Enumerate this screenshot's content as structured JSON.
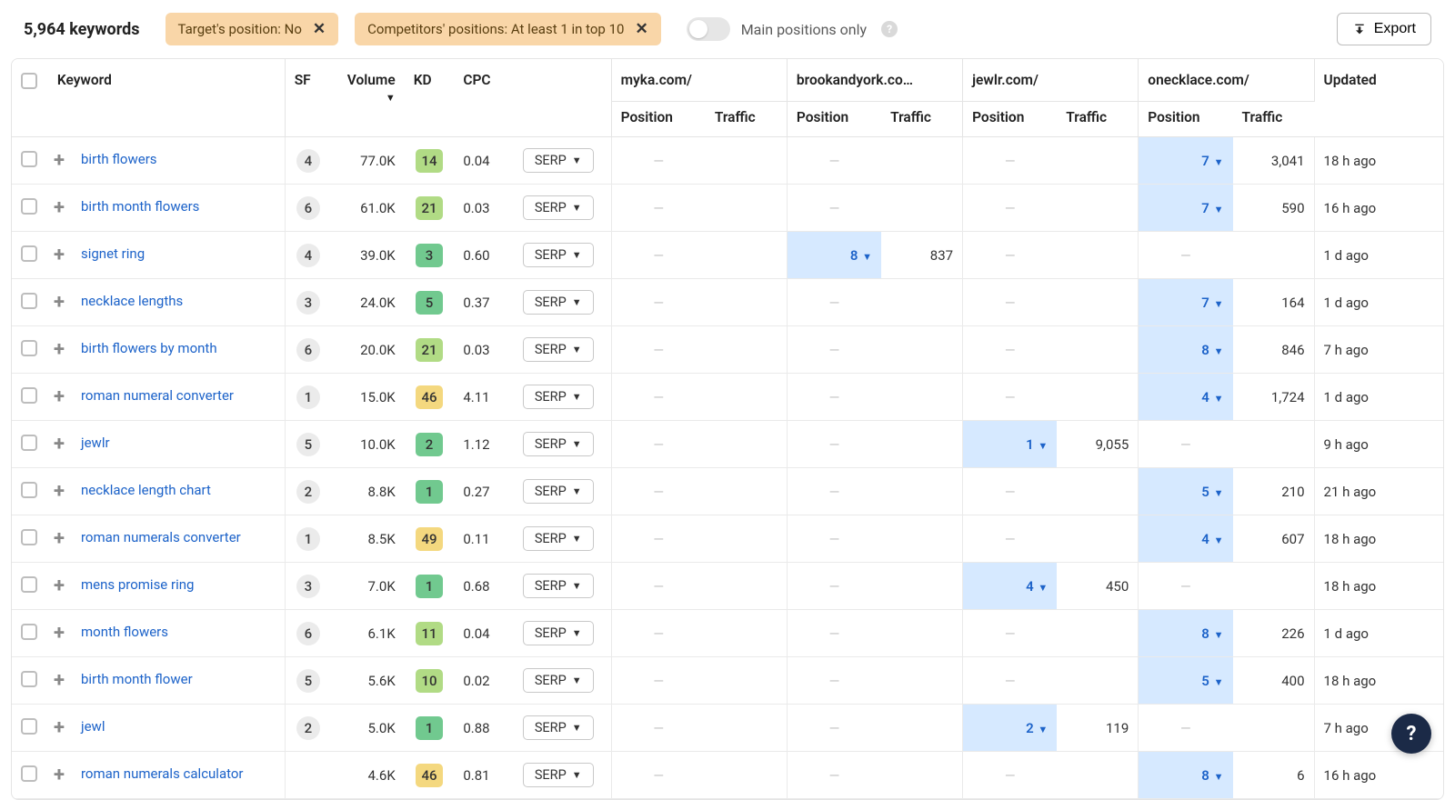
{
  "header": {
    "count_label": "5,964 keywords",
    "filters": [
      {
        "label": "Target's position: No"
      },
      {
        "label": "Competitors' positions: At least 1 in top 10"
      }
    ],
    "toggle_label": "Main positions only",
    "export_label": "Export"
  },
  "columns": {
    "keyword": "Keyword",
    "sf": "SF",
    "volume": "Volume",
    "kd": "KD",
    "cpc": "CPC",
    "updated": "Updated",
    "position": "Position",
    "traffic": "Traffic"
  },
  "sites": [
    "myka.com/",
    "brookandyork.co…",
    "jewlr.com/",
    "onecklace.com/"
  ],
  "serp_label": "SERP",
  "rows": [
    {
      "keyword": "birth flowers",
      "sf": "4",
      "volume": "77.0K",
      "kd": "14",
      "kd_class": "kd-lime",
      "cpc": "0.04",
      "sites": [
        {
          "position": "",
          "traffic": ""
        },
        {
          "position": "",
          "traffic": ""
        },
        {
          "position": "",
          "traffic": ""
        },
        {
          "position": "7",
          "traffic": "3,041"
        }
      ],
      "updated": "18 h ago"
    },
    {
      "keyword": "birth month flowers",
      "sf": "6",
      "volume": "61.0K",
      "kd": "21",
      "kd_class": "kd-lime",
      "cpc": "0.03",
      "sites": [
        {
          "position": "",
          "traffic": ""
        },
        {
          "position": "",
          "traffic": ""
        },
        {
          "position": "",
          "traffic": ""
        },
        {
          "position": "7",
          "traffic": "590"
        }
      ],
      "updated": "16 h ago"
    },
    {
      "keyword": "signet ring",
      "sf": "4",
      "volume": "39.0K",
      "kd": "3",
      "kd_class": "kd-green",
      "cpc": "0.60",
      "sites": [
        {
          "position": "",
          "traffic": ""
        },
        {
          "position": "8",
          "traffic": "837"
        },
        {
          "position": "",
          "traffic": ""
        },
        {
          "position": "",
          "traffic": ""
        }
      ],
      "updated": "1 d ago"
    },
    {
      "keyword": "necklace lengths",
      "sf": "3",
      "volume": "24.0K",
      "kd": "5",
      "kd_class": "kd-green",
      "cpc": "0.37",
      "sites": [
        {
          "position": "",
          "traffic": ""
        },
        {
          "position": "",
          "traffic": ""
        },
        {
          "position": "",
          "traffic": ""
        },
        {
          "position": "7",
          "traffic": "164"
        }
      ],
      "updated": "1 d ago"
    },
    {
      "keyword": "birth flowers by month",
      "sf": "6",
      "volume": "20.0K",
      "kd": "21",
      "kd_class": "kd-lime",
      "cpc": "0.03",
      "sites": [
        {
          "position": "",
          "traffic": ""
        },
        {
          "position": "",
          "traffic": ""
        },
        {
          "position": "",
          "traffic": ""
        },
        {
          "position": "8",
          "traffic": "846"
        }
      ],
      "updated": "7 h ago"
    },
    {
      "keyword": "roman numeral converter",
      "sf": "1",
      "volume": "15.0K",
      "kd": "46",
      "kd_class": "kd-yellow",
      "cpc": "4.11",
      "sites": [
        {
          "position": "",
          "traffic": ""
        },
        {
          "position": "",
          "traffic": ""
        },
        {
          "position": "",
          "traffic": ""
        },
        {
          "position": "4",
          "traffic": "1,724"
        }
      ],
      "updated": "1 d ago"
    },
    {
      "keyword": "jewlr",
      "sf": "5",
      "volume": "10.0K",
      "kd": "2",
      "kd_class": "kd-green",
      "cpc": "1.12",
      "sites": [
        {
          "position": "",
          "traffic": ""
        },
        {
          "position": "",
          "traffic": ""
        },
        {
          "position": "1",
          "traffic": "9,055"
        },
        {
          "position": "",
          "traffic": ""
        }
      ],
      "updated": "9 h ago"
    },
    {
      "keyword": "necklace length chart",
      "sf": "2",
      "volume": "8.8K",
      "kd": "1",
      "kd_class": "kd-green",
      "cpc": "0.27",
      "sites": [
        {
          "position": "",
          "traffic": ""
        },
        {
          "position": "",
          "traffic": ""
        },
        {
          "position": "",
          "traffic": ""
        },
        {
          "position": "5",
          "traffic": "210"
        }
      ],
      "updated": "21 h ago"
    },
    {
      "keyword": "roman numerals converter",
      "sf": "1",
      "volume": "8.5K",
      "kd": "49",
      "kd_class": "kd-yellow",
      "cpc": "0.11",
      "sites": [
        {
          "position": "",
          "traffic": ""
        },
        {
          "position": "",
          "traffic": ""
        },
        {
          "position": "",
          "traffic": ""
        },
        {
          "position": "4",
          "traffic": "607"
        }
      ],
      "updated": "18 h ago"
    },
    {
      "keyword": "mens promise ring",
      "sf": "3",
      "volume": "7.0K",
      "kd": "1",
      "kd_class": "kd-green",
      "cpc": "0.68",
      "sites": [
        {
          "position": "",
          "traffic": ""
        },
        {
          "position": "",
          "traffic": ""
        },
        {
          "position": "4",
          "traffic": "450"
        },
        {
          "position": "",
          "traffic": ""
        }
      ],
      "updated": "18 h ago"
    },
    {
      "keyword": "month flowers",
      "sf": "6",
      "volume": "6.1K",
      "kd": "11",
      "kd_class": "kd-lime",
      "cpc": "0.04",
      "sites": [
        {
          "position": "",
          "traffic": ""
        },
        {
          "position": "",
          "traffic": ""
        },
        {
          "position": "",
          "traffic": ""
        },
        {
          "position": "8",
          "traffic": "226"
        }
      ],
      "updated": "1 d ago"
    },
    {
      "keyword": "birth month flower",
      "sf": "5",
      "volume": "5.6K",
      "kd": "10",
      "kd_class": "kd-lime",
      "cpc": "0.02",
      "sites": [
        {
          "position": "",
          "traffic": ""
        },
        {
          "position": "",
          "traffic": ""
        },
        {
          "position": "",
          "traffic": ""
        },
        {
          "position": "5",
          "traffic": "400"
        }
      ],
      "updated": "18 h ago"
    },
    {
      "keyword": "jewl",
      "sf": "2",
      "volume": "5.0K",
      "kd": "1",
      "kd_class": "kd-green",
      "cpc": "0.88",
      "sites": [
        {
          "position": "",
          "traffic": ""
        },
        {
          "position": "",
          "traffic": ""
        },
        {
          "position": "2",
          "traffic": "119"
        },
        {
          "position": "",
          "traffic": ""
        }
      ],
      "updated": "7 h ago"
    },
    {
      "keyword": "roman numerals calculator",
      "sf": "",
      "volume": "4.6K",
      "kd": "46",
      "kd_class": "kd-yellow",
      "cpc": "0.81",
      "sites": [
        {
          "position": "",
          "traffic": ""
        },
        {
          "position": "",
          "traffic": ""
        },
        {
          "position": "",
          "traffic": ""
        },
        {
          "position": "8",
          "traffic": "6"
        }
      ],
      "updated": "16 h ago"
    }
  ]
}
